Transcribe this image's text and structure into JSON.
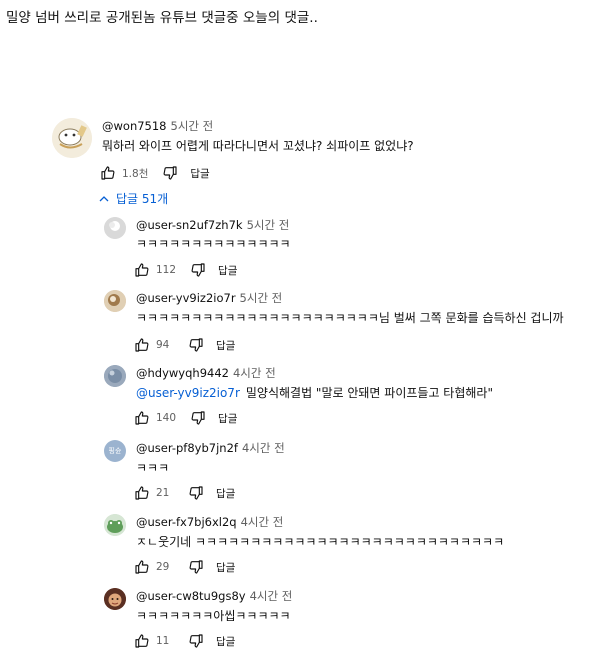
{
  "post": {
    "title": "밀양 넘버 쓰리로 공개된놈 유튜브 댓글중 오늘의 댓글.."
  },
  "main_comment": {
    "author": "@won7518",
    "time": "5시간 전",
    "text": "뭐하러 와이프 어렵게 따라다니면서 꼬셨냐? 쇠파이프 없었냐?",
    "likes": "1.8천",
    "reply_label": "답글",
    "replies_toggle": "답글 51개"
  },
  "replies": [
    {
      "author": "@user-sn2uf7zh7k",
      "time": "5시간 전",
      "text": "ㅋㅋㅋㅋㅋㅋㅋㅋㅋㅋㅋㅋㅋㅋ",
      "likes": "112",
      "reply_label": "답글"
    },
    {
      "author": "@user-yv9iz2io7r",
      "time": "5시간 전",
      "text": "ㅋㅋㅋㅋㅋㅋㅋㅋㅋㅋㅋㅋㅋㅋㅋㅋㅋㅋㅋㅋㅋㅋ님 벌써 그쪽 문화를 습득하신 겁니까",
      "likes": "94",
      "reply_label": "답글"
    },
    {
      "author": "@hdywyqh9442",
      "time": "4시간 전",
      "mention": "@user-yv9iz2io7r",
      "text": "밀양식해결법 \"말로 안돼면 파이프들고 타협해라\"",
      "likes": "140",
      "reply_label": "답글"
    },
    {
      "author": "@user-pf8yb7jn2f",
      "time": "4시간 전",
      "text": "ㅋㅋㅋ",
      "likes": "21",
      "reply_label": "답글"
    },
    {
      "author": "@user-fx7bj6xl2q",
      "time": "4시간 전",
      "text": "ㅈㄴ웃기네 ㅋㅋㅋㅋㅋㅋㅋㅋㅋㅋㅋㅋㅋㅋㅋㅋㅋㅋㅋㅋㅋㅋㅋㅋㅋㅋㅋㅋ",
      "likes": "29",
      "reply_label": "답글"
    },
    {
      "author": "@user-cw8tu9gs8y",
      "time": "4시간 전",
      "text": "ㅋㅋㅋㅋㅋㅋㅋ아씹ㅋㅋㅋㅋㅋ",
      "likes": "11",
      "reply_label": "답글"
    }
  ],
  "avatar_labels": {
    "pf8yb7jn2f": "핑슌"
  },
  "colors": {
    "link": "#065fd4",
    "secondary_text": "#606060",
    "text": "#0f0f0f"
  }
}
